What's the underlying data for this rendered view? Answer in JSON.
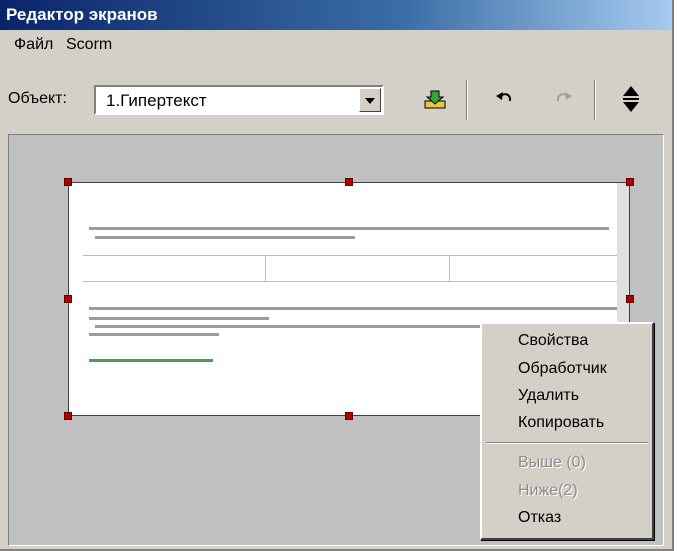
{
  "window": {
    "title": "Редактор экранов"
  },
  "menu": {
    "items": [
      {
        "label": "Файл"
      },
      {
        "label": "Scorm"
      }
    ]
  },
  "toolbar": {
    "object_label": "Объект:",
    "object_value": "1.Гипертекст",
    "icons": [
      "import-icon",
      "undo-icon",
      "redo-icon",
      "resize-vertical-icon"
    ]
  },
  "context_menu": {
    "items": [
      {
        "label": "Свойства",
        "enabled": true
      },
      {
        "label": "Обработчик",
        "enabled": true
      },
      {
        "label": "Удалить",
        "enabled": true
      },
      {
        "label": "Копировать",
        "enabled": true
      },
      {
        "label": "Выше (0)",
        "enabled": false
      },
      {
        "label": "Ниже(2)",
        "enabled": false
      },
      {
        "label": "Отказ",
        "enabled": true
      }
    ]
  },
  "colors": {
    "title_start": "#0a246a",
    "title_end": "#a6caf0",
    "handle": "#b00000",
    "face": "#d4d0c8"
  }
}
